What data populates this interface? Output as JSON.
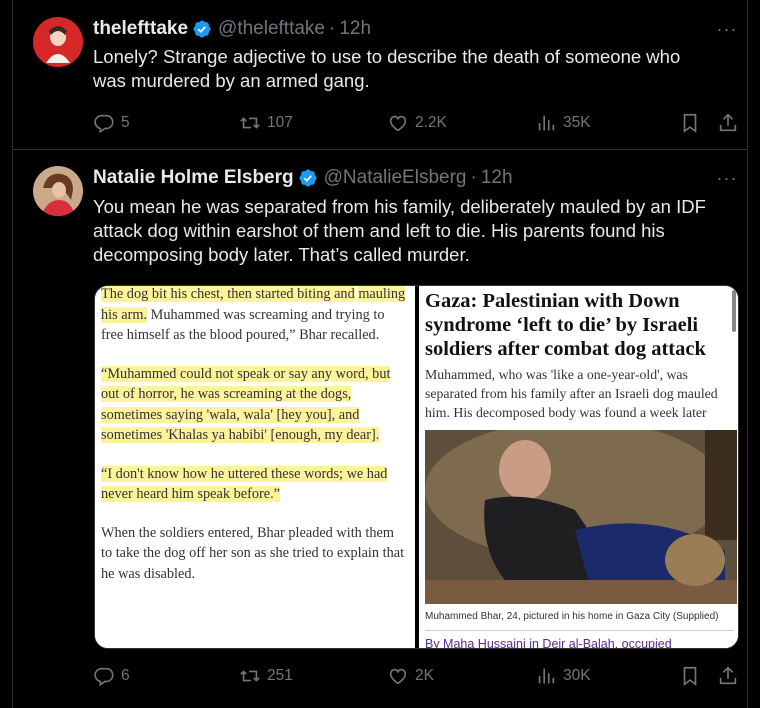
{
  "tweets": [
    {
      "name": "thelefttake",
      "handle": "@thelefttake",
      "dot": "·",
      "time": "12h",
      "text": "Lonely? Strange adjective to use to describe the death of someone who\nwas murdered by an armed gang.",
      "replies": "5",
      "reposts": "107",
      "likes": "2.2K",
      "views": "35K"
    },
    {
      "name": "Natalie Holme Elsberg",
      "handle": "@NatalieElsberg",
      "dot": "·",
      "time": "12h",
      "text": "You mean he was separated from his family, deliberately mauled by an IDF\nattack dog within earshot of them and left to die. His parents found his\ndecomposing body later. That’s called murder.",
      "replies": "6",
      "reposts": "251",
      "likes": "2K",
      "views": "30K",
      "media": {
        "left_panel": {
          "p1a": "The dog bit his chest, then started biting and",
          "p1b": "mauling his arm.",
          "p1c": " Muhammed was screaming and trying to free himself as the blood poured,” Bhar recalled.",
          "p2": "“Muhammed could not speak or say any word, but out of horror, he was screaming at the dogs, sometimes saying 'wala, wala' [hey you], and sometimes 'Khalas ya habibi' [enough, my dear].",
          "p3": "“I don't know how he uttered these words; we had never heard him speak before.”",
          "p4": "When the soldiers entered, Bhar pleaded with them to take the dog off her son as she tried to explain that he was disabled."
        },
        "right_panel": {
          "title": "Gaza: Palestinian with Down syndrome ‘left to die’ by Israeli soldiers after combat dog attack",
          "subtitle": "Muhammed, who was 'like a one-year-old', was separated from his family after an Israeli dog mauled him. His decomposed body was found a week later",
          "caption": "Muhammed Bhar, 24, pictured in his home in Gaza City (Supplied)",
          "byline": "By Maha Hussaini in Deir al-Balah, occupied"
        }
      }
    }
  ],
  "icons": {
    "verified": "verified-badge-icon",
    "more": "more-options-icon",
    "reply": "reply-icon",
    "repost": "repost-icon",
    "like": "like-icon",
    "views": "views-icon",
    "bookmark": "bookmark-icon",
    "share": "share-icon"
  },
  "colors": {
    "background": "#000000",
    "text": "#e7e9ea",
    "muted": "#71767b",
    "verified": "#1d9bf0",
    "highlight": "#fdf39a"
  },
  "more_glyph": "···"
}
